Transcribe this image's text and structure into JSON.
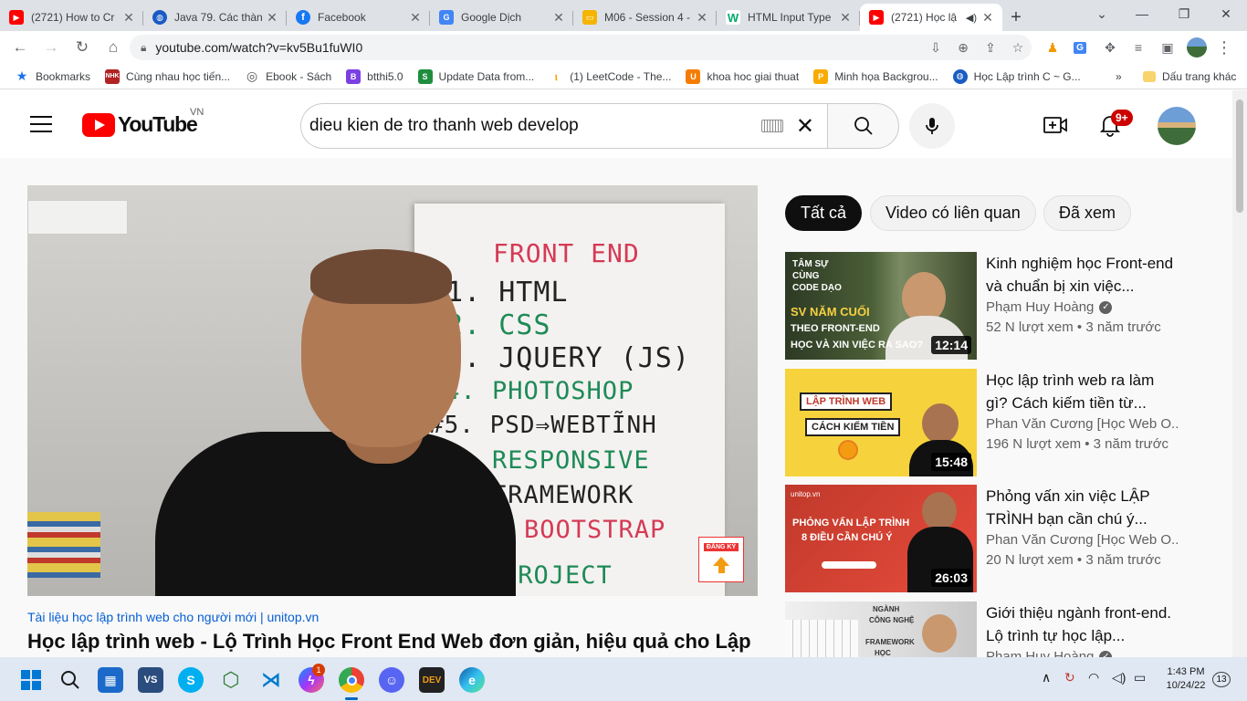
{
  "browser": {
    "tabs": [
      {
        "title": "(2721) How to Cr",
        "icon": "youtube-icon",
        "color": "#ff0000"
      },
      {
        "title": "Java 79. Các thàn",
        "icon": "globe-icon",
        "color": "#1a5bc4"
      },
      {
        "title": "Facebook",
        "icon": "facebook-icon",
        "color": "#1877f2"
      },
      {
        "title": "Google Dịch",
        "icon": "google-translate-icon",
        "color": "#4285f4"
      },
      {
        "title": "M06 - Session 4 -",
        "icon": "slides-icon",
        "color": "#f4b400"
      },
      {
        "title": "HTML Input Type",
        "icon": "w3schools-icon",
        "color": "#04aa6d"
      },
      {
        "title": "(2721) Học lậ",
        "icon": "youtube-icon",
        "color": "#ff0000",
        "active": true
      }
    ],
    "url": "youtube.com/watch?v=kv5Bu1fuWI0",
    "bookmarks": [
      {
        "label": "Bookmarks",
        "icon": "star-icon",
        "color": "#1a73e8"
      },
      {
        "label": "Cùng nhau học tiến...",
        "icon": "nhk-icon",
        "color": "#b22222"
      },
      {
        "label": "Ebook - Sách",
        "icon": "ebook-icon",
        "color": "#555555"
      },
      {
        "label": "btthi5.0",
        "icon": "b-icon",
        "color": "#7b3fe4"
      },
      {
        "label": "Update Data from...",
        "icon": "s-icon",
        "color": "#1e8e3e"
      },
      {
        "label": "(1) LeetCode - The...",
        "icon": "leetcode-icon",
        "color": "#ffa116"
      },
      {
        "label": "khoa hoc giai thuat",
        "icon": "u-icon",
        "color": "#f57c00"
      },
      {
        "label": "Minh họa Backgrou...",
        "icon": "p-icon",
        "color": "#f9ab00"
      },
      {
        "label": "Học Lập trình C ~ G...",
        "icon": "globe-icon",
        "color": "#1a5bc4"
      }
    ],
    "other_bookmarks": "Dấu trang khác"
  },
  "youtube": {
    "country": "VN",
    "logo_text": "YouTube",
    "search_query": "dieu kien de tro thanh web develop",
    "notifications_badge": "9+"
  },
  "video": {
    "channel_link": "Tài liệu học lập trình web cho người mới | unitop.vn",
    "title": "Học lập trình web - Lộ Trình Học Front End Web đơn giản, hiệu quả cho Lập",
    "board_lines": [
      "FRONT END",
      "#1. HTML",
      "#2. CSS",
      "#3. JQUERY (JS)",
      "#4. PHOTOSHOP",
      "#5. PSD⇒WEBTĨNH",
      "#6. RESPONSIVE",
      "#7. FRAMEWORK",
      "BOOTSTRAP",
      "PROJECT"
    ],
    "subscribe_label": "ĐĂNG KÝ"
  },
  "chips": [
    "Tất cả",
    "Video có liên quan",
    "Đã xem"
  ],
  "related": [
    {
      "title": "Kinh nghiệm học Front-end và chuẩn bị xin việc...",
      "channel": "Phạm Huy Hoàng",
      "verified": true,
      "meta": "52 N lượt xem • 3 năm trước",
      "duration": "12:14",
      "thumb_text": [
        "TÂM SỰ",
        "CÙNG",
        "CODE DẠO",
        "SV NĂM CUỐI",
        "THEO FRONT-END",
        "HỌC VÀ XIN VIỆC RA SAO?"
      ]
    },
    {
      "title": "Học lập trình web ra làm gì? Cách kiếm tiền từ...",
      "channel": "Phan Văn Cương [Học Web O...",
      "verified": false,
      "meta": "196 N lượt xem • 3 năm trước",
      "duration": "15:48",
      "thumb_text": [
        "LẬP TRÌNH WEB",
        "CÁCH KIẾM TIỀN"
      ]
    },
    {
      "title": "Phỏng vấn xin việc LẬP TRÌNH bạn cần chú ý...",
      "channel": "Phan Văn Cương [Học Web O...",
      "verified": false,
      "meta": "20 N lượt xem • 3 năm trước",
      "duration": "26:03",
      "thumb_text": [
        "unitop.vn",
        "PHỎNG VẤN LẬP TRÌNH",
        "8 ĐIỀU CẦN CHÚ Ý"
      ]
    },
    {
      "title": "Giới thiệu ngành front-end. Lộ trình tự học lập...",
      "channel": "Phạm Huy Hoàng",
      "verified": true,
      "meta": "",
      "duration": "",
      "thumb_text": [
        "NGÀNH",
        "CÔNG NGHỆ",
        "FRAMEWORK",
        "HỌC"
      ]
    }
  ],
  "taskbar": {
    "time": "1:43 PM",
    "date": "10/24/22",
    "messenger_badge": "1",
    "notification_count": "13"
  }
}
